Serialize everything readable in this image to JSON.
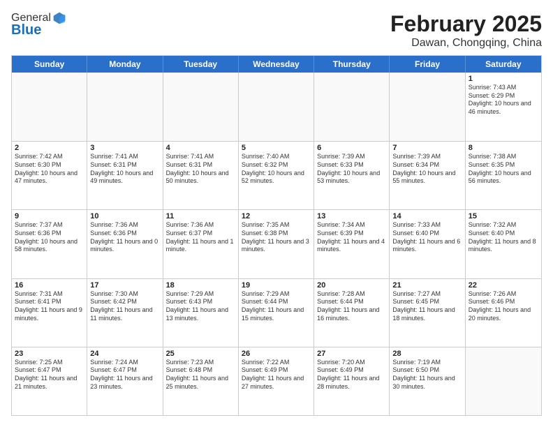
{
  "header": {
    "logo_general": "General",
    "logo_blue": "Blue",
    "month": "February 2025",
    "location": "Dawan, Chongqing, China"
  },
  "weekdays": [
    "Sunday",
    "Monday",
    "Tuesday",
    "Wednesday",
    "Thursday",
    "Friday",
    "Saturday"
  ],
  "weeks": [
    [
      {
        "day": "",
        "info": ""
      },
      {
        "day": "",
        "info": ""
      },
      {
        "day": "",
        "info": ""
      },
      {
        "day": "",
        "info": ""
      },
      {
        "day": "",
        "info": ""
      },
      {
        "day": "",
        "info": ""
      },
      {
        "day": "1",
        "info": "Sunrise: 7:43 AM\nSunset: 6:29 PM\nDaylight: 10 hours and 46 minutes."
      }
    ],
    [
      {
        "day": "2",
        "info": "Sunrise: 7:42 AM\nSunset: 6:30 PM\nDaylight: 10 hours and 47 minutes."
      },
      {
        "day": "3",
        "info": "Sunrise: 7:41 AM\nSunset: 6:31 PM\nDaylight: 10 hours and 49 minutes."
      },
      {
        "day": "4",
        "info": "Sunrise: 7:41 AM\nSunset: 6:31 PM\nDaylight: 10 hours and 50 minutes."
      },
      {
        "day": "5",
        "info": "Sunrise: 7:40 AM\nSunset: 6:32 PM\nDaylight: 10 hours and 52 minutes."
      },
      {
        "day": "6",
        "info": "Sunrise: 7:39 AM\nSunset: 6:33 PM\nDaylight: 10 hours and 53 minutes."
      },
      {
        "day": "7",
        "info": "Sunrise: 7:39 AM\nSunset: 6:34 PM\nDaylight: 10 hours and 55 minutes."
      },
      {
        "day": "8",
        "info": "Sunrise: 7:38 AM\nSunset: 6:35 PM\nDaylight: 10 hours and 56 minutes."
      }
    ],
    [
      {
        "day": "9",
        "info": "Sunrise: 7:37 AM\nSunset: 6:36 PM\nDaylight: 10 hours and 58 minutes."
      },
      {
        "day": "10",
        "info": "Sunrise: 7:36 AM\nSunset: 6:36 PM\nDaylight: 11 hours and 0 minutes."
      },
      {
        "day": "11",
        "info": "Sunrise: 7:36 AM\nSunset: 6:37 PM\nDaylight: 11 hours and 1 minute."
      },
      {
        "day": "12",
        "info": "Sunrise: 7:35 AM\nSunset: 6:38 PM\nDaylight: 11 hours and 3 minutes."
      },
      {
        "day": "13",
        "info": "Sunrise: 7:34 AM\nSunset: 6:39 PM\nDaylight: 11 hours and 4 minutes."
      },
      {
        "day": "14",
        "info": "Sunrise: 7:33 AM\nSunset: 6:40 PM\nDaylight: 11 hours and 6 minutes."
      },
      {
        "day": "15",
        "info": "Sunrise: 7:32 AM\nSunset: 6:40 PM\nDaylight: 11 hours and 8 minutes."
      }
    ],
    [
      {
        "day": "16",
        "info": "Sunrise: 7:31 AM\nSunset: 6:41 PM\nDaylight: 11 hours and 9 minutes."
      },
      {
        "day": "17",
        "info": "Sunrise: 7:30 AM\nSunset: 6:42 PM\nDaylight: 11 hours and 11 minutes."
      },
      {
        "day": "18",
        "info": "Sunrise: 7:29 AM\nSunset: 6:43 PM\nDaylight: 11 hours and 13 minutes."
      },
      {
        "day": "19",
        "info": "Sunrise: 7:29 AM\nSunset: 6:44 PM\nDaylight: 11 hours and 15 minutes."
      },
      {
        "day": "20",
        "info": "Sunrise: 7:28 AM\nSunset: 6:44 PM\nDaylight: 11 hours and 16 minutes."
      },
      {
        "day": "21",
        "info": "Sunrise: 7:27 AM\nSunset: 6:45 PM\nDaylight: 11 hours and 18 minutes."
      },
      {
        "day": "22",
        "info": "Sunrise: 7:26 AM\nSunset: 6:46 PM\nDaylight: 11 hours and 20 minutes."
      }
    ],
    [
      {
        "day": "23",
        "info": "Sunrise: 7:25 AM\nSunset: 6:47 PM\nDaylight: 11 hours and 21 minutes."
      },
      {
        "day": "24",
        "info": "Sunrise: 7:24 AM\nSunset: 6:47 PM\nDaylight: 11 hours and 23 minutes."
      },
      {
        "day": "25",
        "info": "Sunrise: 7:23 AM\nSunset: 6:48 PM\nDaylight: 11 hours and 25 minutes."
      },
      {
        "day": "26",
        "info": "Sunrise: 7:22 AM\nSunset: 6:49 PM\nDaylight: 11 hours and 27 minutes."
      },
      {
        "day": "27",
        "info": "Sunrise: 7:20 AM\nSunset: 6:49 PM\nDaylight: 11 hours and 28 minutes."
      },
      {
        "day": "28",
        "info": "Sunrise: 7:19 AM\nSunset: 6:50 PM\nDaylight: 11 hours and 30 minutes."
      },
      {
        "day": "",
        "info": ""
      }
    ]
  ]
}
